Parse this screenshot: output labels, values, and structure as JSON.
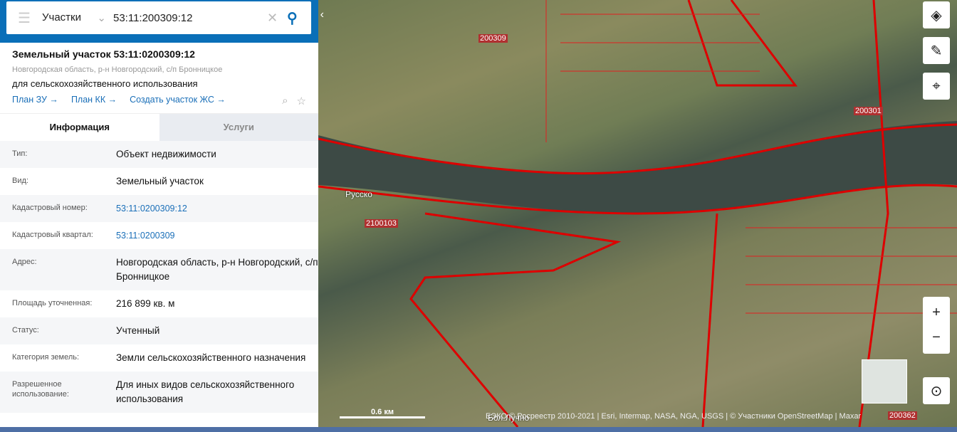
{
  "search": {
    "layer": "Участки",
    "query": "53:11:200309:12"
  },
  "card": {
    "title": "Земельный участок 53:11:0200309:12",
    "address": "Новгородская область, р-н Новгородский, с/п Бронницкое",
    "purpose": "для сельскохозяйственного использования",
    "links": [
      "План ЗУ →",
      "План КК →",
      "Создать участок ЖС →"
    ]
  },
  "tabs": [
    "Информация",
    "Услуги"
  ],
  "info": [
    {
      "k": "Тип:",
      "v": "Объект недвижимости"
    },
    {
      "k": "Вид:",
      "v": "Земельный участок"
    },
    {
      "k": "Кадастровый номер:",
      "v": "53:11:0200309:12"
    },
    {
      "k": "Кадастровый квартал:",
      "v": "53:11:0200309"
    },
    {
      "k": "Адрес:",
      "v": "Новгородская область, р-н Новгородский, с/п Бронницкое"
    },
    {
      "k": "Площадь уточненная:",
      "v": "216 899 кв. м"
    },
    {
      "k": "Статус:",
      "v": "Учтенный"
    },
    {
      "k": "Категория земель:",
      "v": "Земли сельскохозяйственного назначения"
    },
    {
      "k": "Разрешенное использование:",
      "v": "Для иных видов сельскохозяйственного использования"
    }
  ],
  "map": {
    "scale": "0.6 км",
    "attribution": "ЕЭКО © Росреестр 2010-2021 | Esri, Intermap, NASA, NGA, USGS | © Участники OpenStreetMap | Maxar",
    "labels": [
      "200309",
      "200301",
      "2100103",
      "200362"
    ],
    "places": [
      "Русско",
      "Бол.Лучно"
    ]
  }
}
